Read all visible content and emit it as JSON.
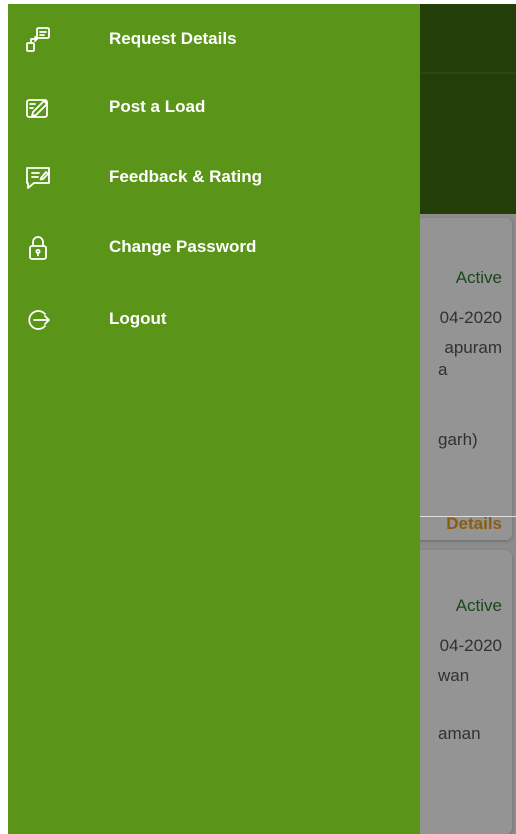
{
  "drawer": {
    "background": "#5a9418",
    "items": [
      {
        "label": "Request Details",
        "icon": "request-details-icon"
      },
      {
        "label": "Post a Load",
        "icon": "post-load-icon"
      },
      {
        "label": "Feedback & Rating",
        "icon": "feedback-icon"
      },
      {
        "label": "Change Password",
        "icon": "lock-icon"
      },
      {
        "label": "Logout",
        "icon": "logout-icon"
      }
    ]
  },
  "background_cards": [
    {
      "status": "Active",
      "date": "04-2020",
      "place": "apuram",
      "place_line2": "a",
      "region": "garh)",
      "link": "Details"
    },
    {
      "status": "Active",
      "date": "04-2020",
      "place": "wan",
      "region": "aman"
    }
  ],
  "colors": {
    "drawer": "#5a9418",
    "header": "#3f6b12",
    "status_active": "#2e7d32",
    "details_link": "#f0a01c"
  }
}
